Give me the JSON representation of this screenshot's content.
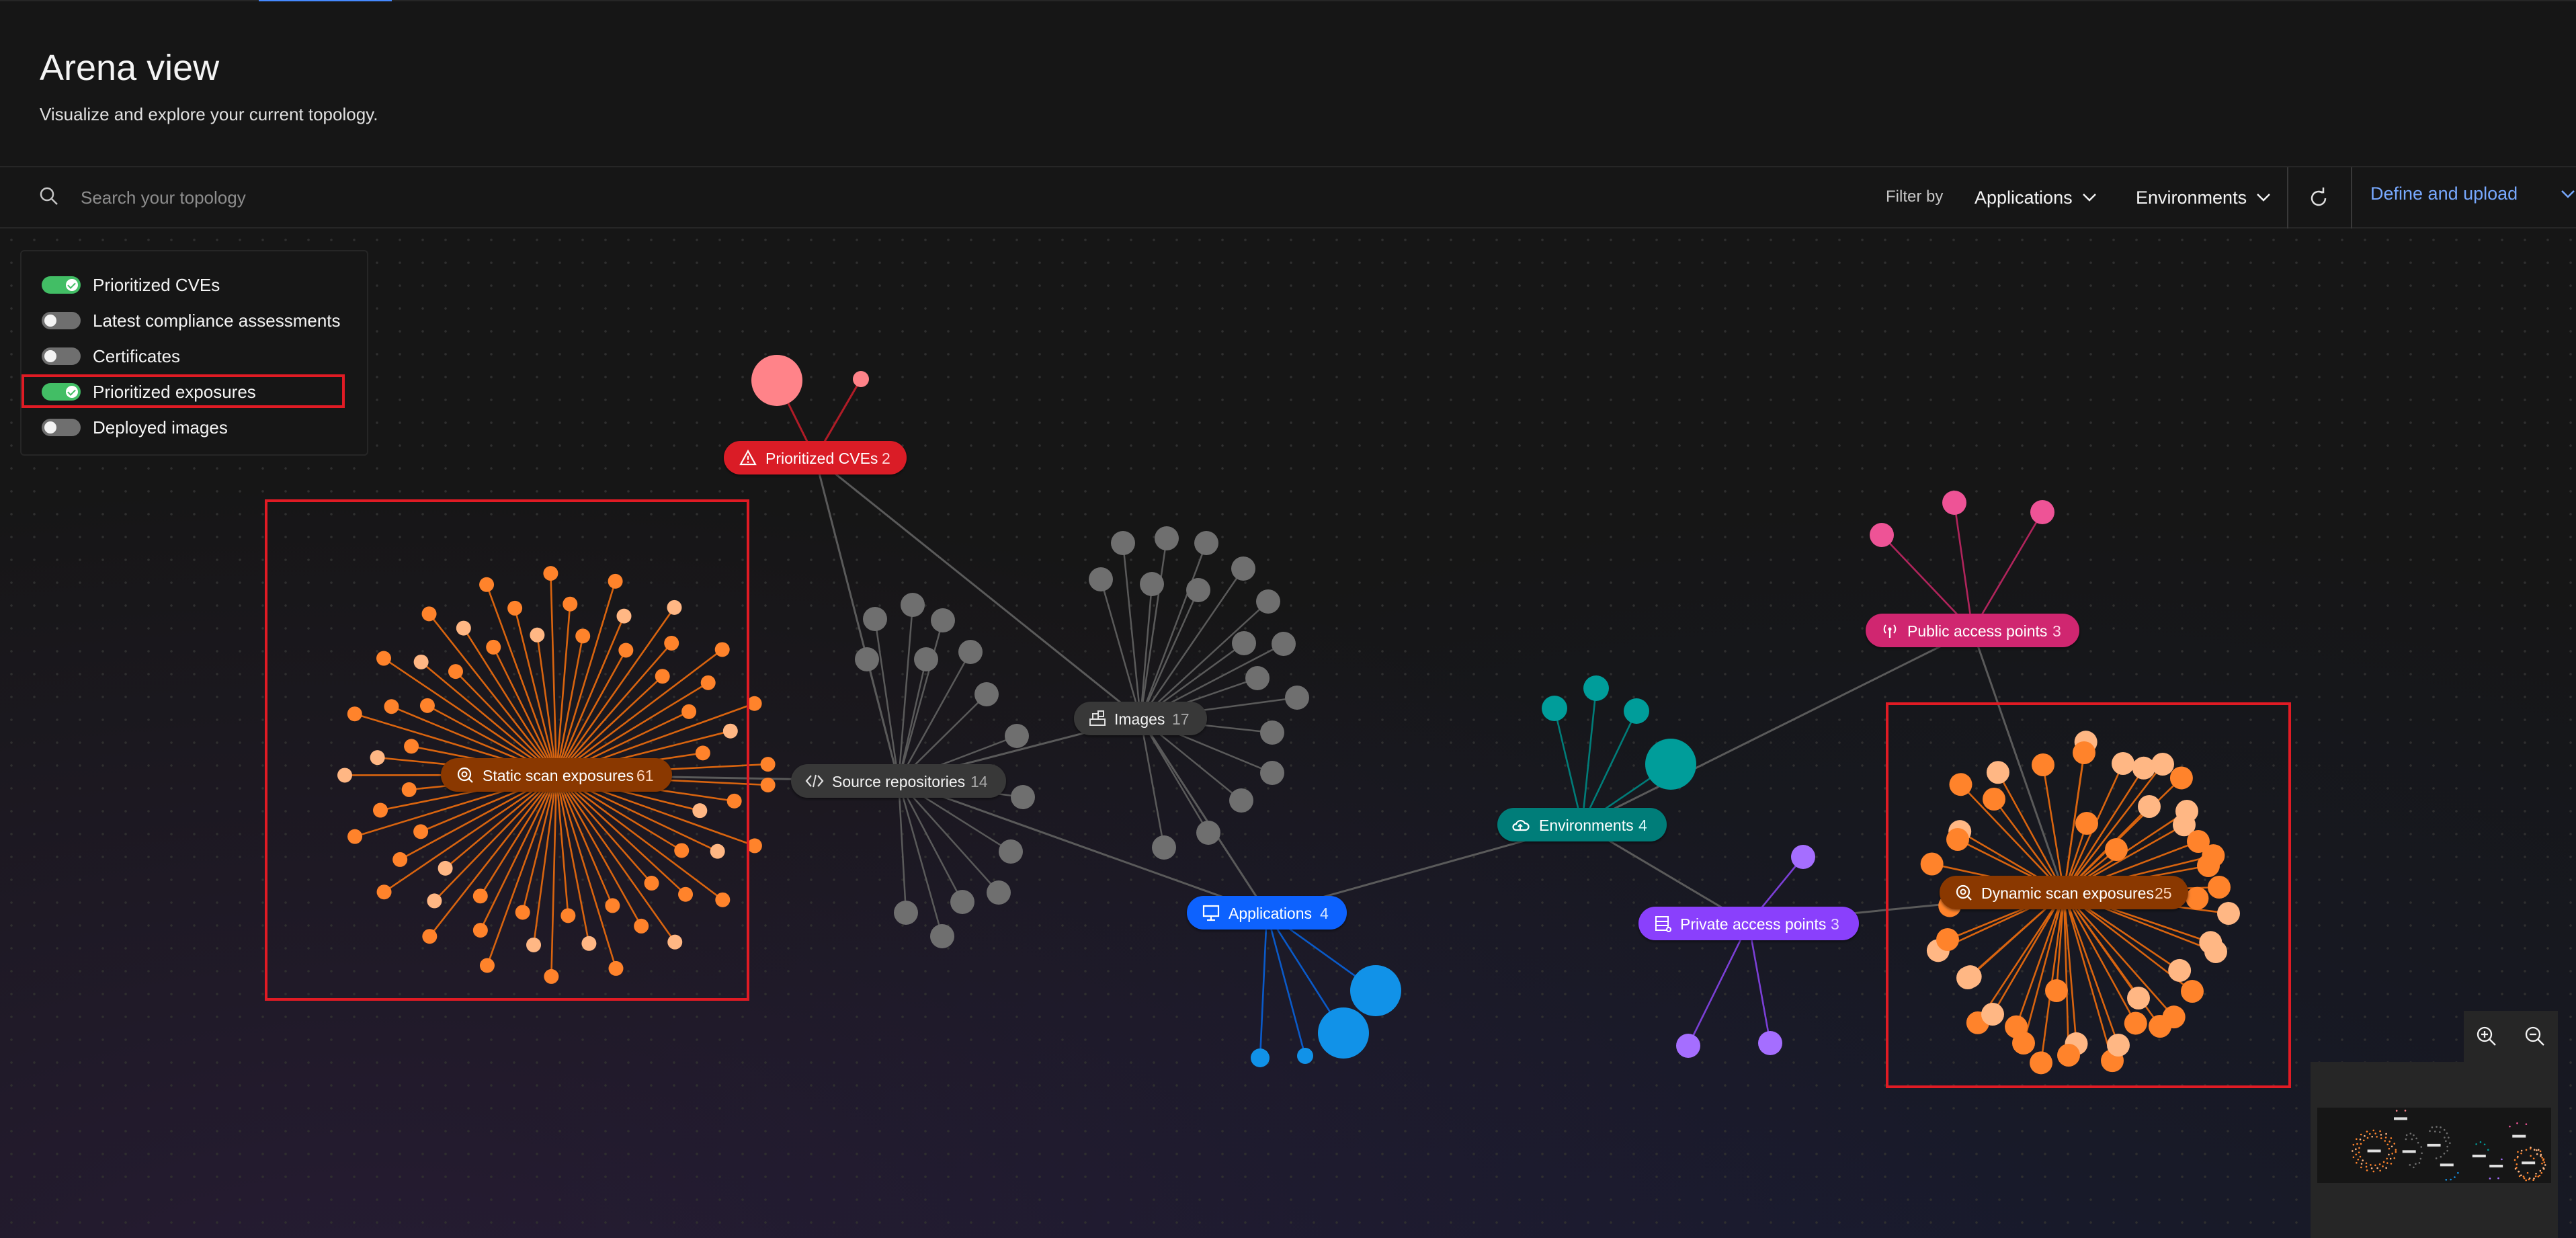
{
  "header": {
    "title": "Arena view",
    "subtitle": "Visualize and explore your current topology."
  },
  "toolbar": {
    "search_placeholder": "Search your topology",
    "filter_label": "Filter by",
    "filter_applications": "Applications",
    "filter_environments": "Environments",
    "define_upload": "Define and upload"
  },
  "legend": {
    "items": [
      {
        "label": "Prioritized CVEs",
        "on": true
      },
      {
        "label": "Latest compliance assessments",
        "on": false
      },
      {
        "label": "Certificates",
        "on": false
      },
      {
        "label": "Prioritized exposures",
        "on": true,
        "highlighted": true
      },
      {
        "label": "Deployed images",
        "on": false
      }
    ]
  },
  "nodes": {
    "prioritized_cves": {
      "label": "Prioritized CVEs",
      "count": "2",
      "color": "#da1e28"
    },
    "static_scan": {
      "label": "Static scan exposures",
      "count": "61",
      "color": "#8a3800"
    },
    "source_repos": {
      "label": "Source repositories",
      "count": "14",
      "color": "#393939"
    },
    "images": {
      "label": "Images",
      "count": "17",
      "color": "#393939"
    },
    "applications": {
      "label": "Applications",
      "count": "4",
      "color": "#0f62fe"
    },
    "environments": {
      "label": "Environments",
      "count": "4",
      "color": "#007d79"
    },
    "public_access": {
      "label": "Public access points",
      "count": "3",
      "color": "#d02670"
    },
    "private_access": {
      "label": "Private access points",
      "count": "3",
      "color": "#8a3ffc"
    },
    "dynamic_scan": {
      "label": "Dynamic scan exposures",
      "count": "25",
      "color": "#8a3800"
    }
  },
  "colors": {
    "accent_link": "#78a9ff",
    "toggle_on": "#42be65",
    "highlight": "#e01b24",
    "exposure_dot": "#ff832b",
    "exposure_dot_light": "#ffb784",
    "cve_dot": "#ff8389",
    "gray_dot": "#6f6f6f",
    "teal_dot": "#009d9a",
    "pink_dot": "#ee5396",
    "blue_dot": "#1192e8",
    "purple_dot": "#a56eff"
  },
  "icons": [
    "search-icon",
    "chevron-down-icon",
    "refresh-icon",
    "zoom-in-icon",
    "zoom-out-icon",
    "warning-icon",
    "code-icon",
    "stack-icon",
    "monitor-icon",
    "cloud-icon",
    "antenna-icon",
    "scan-icon",
    "server-icon"
  ]
}
